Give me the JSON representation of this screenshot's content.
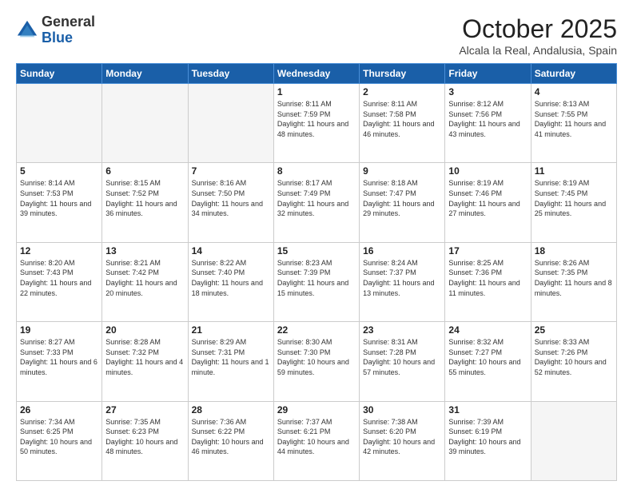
{
  "header": {
    "logo_general": "General",
    "logo_blue": "Blue",
    "month_title": "October 2025",
    "location": "Alcala la Real, Andalusia, Spain"
  },
  "days_of_week": [
    "Sunday",
    "Monday",
    "Tuesday",
    "Wednesday",
    "Thursday",
    "Friday",
    "Saturday"
  ],
  "weeks": [
    [
      {
        "day": "",
        "info": ""
      },
      {
        "day": "",
        "info": ""
      },
      {
        "day": "",
        "info": ""
      },
      {
        "day": "1",
        "info": "Sunrise: 8:11 AM\nSunset: 7:59 PM\nDaylight: 11 hours and 48 minutes."
      },
      {
        "day": "2",
        "info": "Sunrise: 8:11 AM\nSunset: 7:58 PM\nDaylight: 11 hours and 46 minutes."
      },
      {
        "day": "3",
        "info": "Sunrise: 8:12 AM\nSunset: 7:56 PM\nDaylight: 11 hours and 43 minutes."
      },
      {
        "day": "4",
        "info": "Sunrise: 8:13 AM\nSunset: 7:55 PM\nDaylight: 11 hours and 41 minutes."
      }
    ],
    [
      {
        "day": "5",
        "info": "Sunrise: 8:14 AM\nSunset: 7:53 PM\nDaylight: 11 hours and 39 minutes."
      },
      {
        "day": "6",
        "info": "Sunrise: 8:15 AM\nSunset: 7:52 PM\nDaylight: 11 hours and 36 minutes."
      },
      {
        "day": "7",
        "info": "Sunrise: 8:16 AM\nSunset: 7:50 PM\nDaylight: 11 hours and 34 minutes."
      },
      {
        "day": "8",
        "info": "Sunrise: 8:17 AM\nSunset: 7:49 PM\nDaylight: 11 hours and 32 minutes."
      },
      {
        "day": "9",
        "info": "Sunrise: 8:18 AM\nSunset: 7:47 PM\nDaylight: 11 hours and 29 minutes."
      },
      {
        "day": "10",
        "info": "Sunrise: 8:19 AM\nSunset: 7:46 PM\nDaylight: 11 hours and 27 minutes."
      },
      {
        "day": "11",
        "info": "Sunrise: 8:19 AM\nSunset: 7:45 PM\nDaylight: 11 hours and 25 minutes."
      }
    ],
    [
      {
        "day": "12",
        "info": "Sunrise: 8:20 AM\nSunset: 7:43 PM\nDaylight: 11 hours and 22 minutes."
      },
      {
        "day": "13",
        "info": "Sunrise: 8:21 AM\nSunset: 7:42 PM\nDaylight: 11 hours and 20 minutes."
      },
      {
        "day": "14",
        "info": "Sunrise: 8:22 AM\nSunset: 7:40 PM\nDaylight: 11 hours and 18 minutes."
      },
      {
        "day": "15",
        "info": "Sunrise: 8:23 AM\nSunset: 7:39 PM\nDaylight: 11 hours and 15 minutes."
      },
      {
        "day": "16",
        "info": "Sunrise: 8:24 AM\nSunset: 7:37 PM\nDaylight: 11 hours and 13 minutes."
      },
      {
        "day": "17",
        "info": "Sunrise: 8:25 AM\nSunset: 7:36 PM\nDaylight: 11 hours and 11 minutes."
      },
      {
        "day": "18",
        "info": "Sunrise: 8:26 AM\nSunset: 7:35 PM\nDaylight: 11 hours and 8 minutes."
      }
    ],
    [
      {
        "day": "19",
        "info": "Sunrise: 8:27 AM\nSunset: 7:33 PM\nDaylight: 11 hours and 6 minutes."
      },
      {
        "day": "20",
        "info": "Sunrise: 8:28 AM\nSunset: 7:32 PM\nDaylight: 11 hours and 4 minutes."
      },
      {
        "day": "21",
        "info": "Sunrise: 8:29 AM\nSunset: 7:31 PM\nDaylight: 11 hours and 1 minute."
      },
      {
        "day": "22",
        "info": "Sunrise: 8:30 AM\nSunset: 7:30 PM\nDaylight: 10 hours and 59 minutes."
      },
      {
        "day": "23",
        "info": "Sunrise: 8:31 AM\nSunset: 7:28 PM\nDaylight: 10 hours and 57 minutes."
      },
      {
        "day": "24",
        "info": "Sunrise: 8:32 AM\nSunset: 7:27 PM\nDaylight: 10 hours and 55 minutes."
      },
      {
        "day": "25",
        "info": "Sunrise: 8:33 AM\nSunset: 7:26 PM\nDaylight: 10 hours and 52 minutes."
      }
    ],
    [
      {
        "day": "26",
        "info": "Sunrise: 7:34 AM\nSunset: 6:25 PM\nDaylight: 10 hours and 50 minutes."
      },
      {
        "day": "27",
        "info": "Sunrise: 7:35 AM\nSunset: 6:23 PM\nDaylight: 10 hours and 48 minutes."
      },
      {
        "day": "28",
        "info": "Sunrise: 7:36 AM\nSunset: 6:22 PM\nDaylight: 10 hours and 46 minutes."
      },
      {
        "day": "29",
        "info": "Sunrise: 7:37 AM\nSunset: 6:21 PM\nDaylight: 10 hours and 44 minutes."
      },
      {
        "day": "30",
        "info": "Sunrise: 7:38 AM\nSunset: 6:20 PM\nDaylight: 10 hours and 42 minutes."
      },
      {
        "day": "31",
        "info": "Sunrise: 7:39 AM\nSunset: 6:19 PM\nDaylight: 10 hours and 39 minutes."
      },
      {
        "day": "",
        "info": ""
      }
    ]
  ]
}
